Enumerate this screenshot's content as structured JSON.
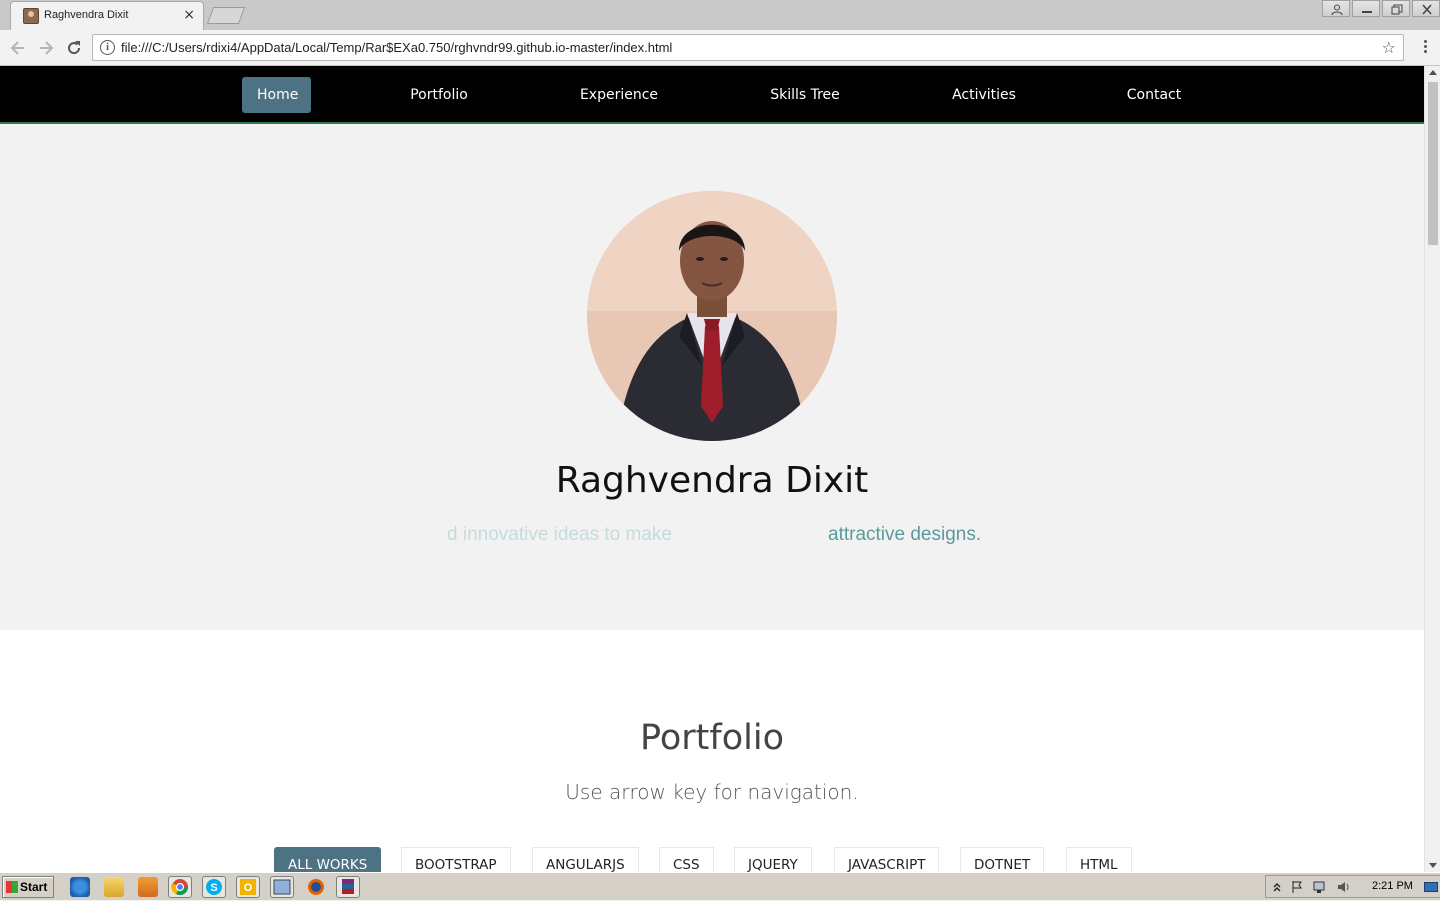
{
  "browser": {
    "tab_title": "Raghvendra Dixit",
    "tab_close": "×",
    "url": "file:///C:/Users/rdixi4/AppData/Local/Temp/Rar$EXa0.750/rghvndr99.github.io-master/index.html",
    "info_glyph": "i",
    "star_glyph": "☆"
  },
  "nav": {
    "items": [
      {
        "label": "Home",
        "active": true
      },
      {
        "label": "Portfolio"
      },
      {
        "label": "Experience"
      },
      {
        "label": "Skills Tree"
      },
      {
        "label": "Activities"
      },
      {
        "label": "Contact"
      }
    ]
  },
  "hero": {
    "name": "Raghvendra Dixit",
    "tagline_part1": "d innovative ideas to make",
    "tagline_part2": "attractive designs."
  },
  "portfolio": {
    "title": "Portfolio",
    "subtitle": "Use arrow key for navigation.",
    "filters": [
      {
        "label": "ALL WORKS",
        "active": true
      },
      {
        "label": "BOOTSTRAP"
      },
      {
        "label": "ANGULARJS"
      },
      {
        "label": "CSS"
      },
      {
        "label": "JQUERY"
      },
      {
        "label": "JAVASCRIPT"
      },
      {
        "label": "DOTNET"
      },
      {
        "label": "HTML"
      }
    ]
  },
  "taskbar": {
    "start_label": "Start",
    "clock": "2:21 PM"
  },
  "colors": {
    "accent": "#4d7283",
    "nav_bg": "#000000",
    "tagline_faded": "#c5dcdc",
    "tagline_strong": "#5b9a9c"
  }
}
